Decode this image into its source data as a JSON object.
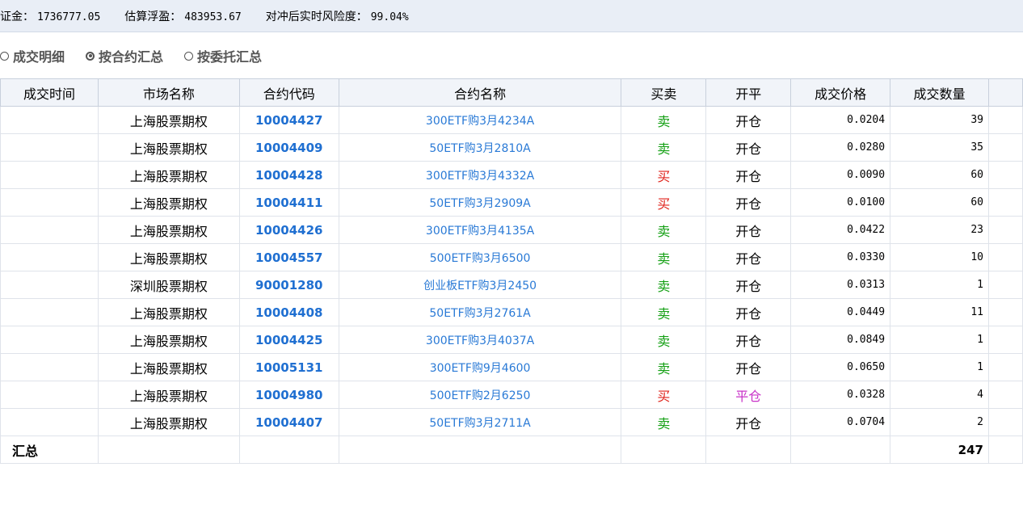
{
  "summary": {
    "margin_label": "保证金：",
    "margin_value": "1736777.05",
    "pnl_label": "估算浮盈：",
    "pnl_value": "483953.67",
    "risk_label": "对冲后实时风险度：",
    "risk_value": "99.04%"
  },
  "view_modes": [
    {
      "label": "成交明细",
      "checked": false
    },
    {
      "label": "按合约汇总",
      "checked": true
    },
    {
      "label": "按委托汇总",
      "checked": false
    }
  ],
  "columns": [
    "成交时间",
    "市场名称",
    "合约代码",
    "合约名称",
    "买卖",
    "开平",
    "成交价格",
    "成交数量"
  ],
  "rows": [
    {
      "time": "",
      "market": "上海股票期权",
      "code": "10004427",
      "name": "300ETF购3月4234A",
      "side": "卖",
      "oc": "开仓",
      "price": "0.0204",
      "qty": "39"
    },
    {
      "time": "",
      "market": "上海股票期权",
      "code": "10004409",
      "name": "50ETF购3月2810A",
      "side": "卖",
      "oc": "开仓",
      "price": "0.0280",
      "qty": "35"
    },
    {
      "time": "",
      "market": "上海股票期权",
      "code": "10004428",
      "name": "300ETF购3月4332A",
      "side": "买",
      "oc": "开仓",
      "price": "0.0090",
      "qty": "60"
    },
    {
      "time": "",
      "market": "上海股票期权",
      "code": "10004411",
      "name": "50ETF购3月2909A",
      "side": "买",
      "oc": "开仓",
      "price": "0.0100",
      "qty": "60"
    },
    {
      "time": "",
      "market": "上海股票期权",
      "code": "10004426",
      "name": "300ETF购3月4135A",
      "side": "卖",
      "oc": "开仓",
      "price": "0.0422",
      "qty": "23"
    },
    {
      "time": "",
      "market": "上海股票期权",
      "code": "10004557",
      "name": "500ETF购3月6500",
      "side": "卖",
      "oc": "开仓",
      "price": "0.0330",
      "qty": "10"
    },
    {
      "time": "",
      "market": "深圳股票期权",
      "code": "90001280",
      "name": "创业板ETF购3月2450",
      "side": "卖",
      "oc": "开仓",
      "price": "0.0313",
      "qty": "1"
    },
    {
      "time": "",
      "market": "上海股票期权",
      "code": "10004408",
      "name": "50ETF购3月2761A",
      "side": "卖",
      "oc": "开仓",
      "price": "0.0449",
      "qty": "11"
    },
    {
      "time": "",
      "market": "上海股票期权",
      "code": "10004425",
      "name": "300ETF购3月4037A",
      "side": "卖",
      "oc": "开仓",
      "price": "0.0849",
      "qty": "1"
    },
    {
      "time": "",
      "market": "上海股票期权",
      "code": "10005131",
      "name": "300ETF购9月4600",
      "side": "卖",
      "oc": "开仓",
      "price": "0.0650",
      "qty": "1"
    },
    {
      "time": "",
      "market": "上海股票期权",
      "code": "10004980",
      "name": "500ETF购2月6250",
      "side": "买",
      "oc": "平仓",
      "price": "0.0328",
      "qty": "4"
    },
    {
      "time": "",
      "market": "上海股票期权",
      "code": "10004407",
      "name": "50ETF购3月2711A",
      "side": "卖",
      "oc": "开仓",
      "price": "0.0704",
      "qty": "2"
    }
  ],
  "total": {
    "label": "汇总",
    "qty": "247"
  },
  "colors": {
    "sell": "#14a014",
    "buy": "#e0241c",
    "close": "#c832c8",
    "code": "#1f6fd1"
  }
}
